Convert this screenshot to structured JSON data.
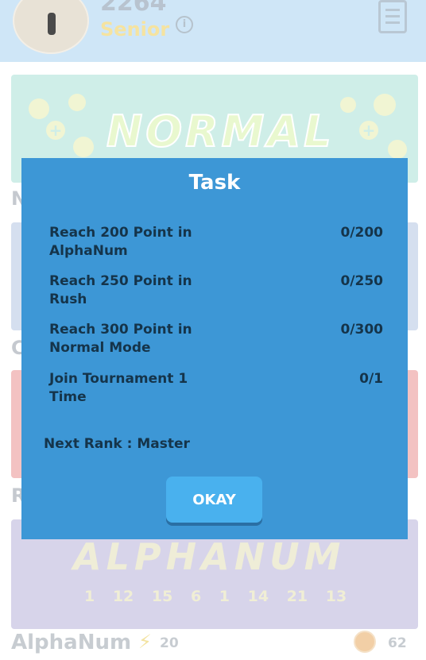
{
  "profile": {
    "points": "2264",
    "rank": "Senior"
  },
  "background": {
    "normal_logo": "NORMAL",
    "alpha_logo": "ALPHANUM",
    "alpha_numbers": "1 12 15 6 1 14 21 13",
    "letters": [
      "N",
      "C",
      "R"
    ],
    "mode_title": "AlphaNum",
    "bolt_count": "20",
    "medal_count": "62"
  },
  "dialog": {
    "title": "Task",
    "tasks": [
      {
        "label": "Reach 200 Point in AlphaNum",
        "progress": "0/200"
      },
      {
        "label": "Reach 250 Point in Rush",
        "progress": "0/250"
      },
      {
        "label": "Reach 300 Point in Normal Mode",
        "progress": "0/300"
      },
      {
        "label": "Join Tournament 1 Time",
        "progress": "0/1"
      }
    ],
    "next_rank": "Next Rank : Master",
    "okay_label": "OKAY"
  },
  "colors": {
    "dialog_bg": "#3d97d6",
    "button_bg": "#49b1ee",
    "task_text": "#15344a"
  }
}
